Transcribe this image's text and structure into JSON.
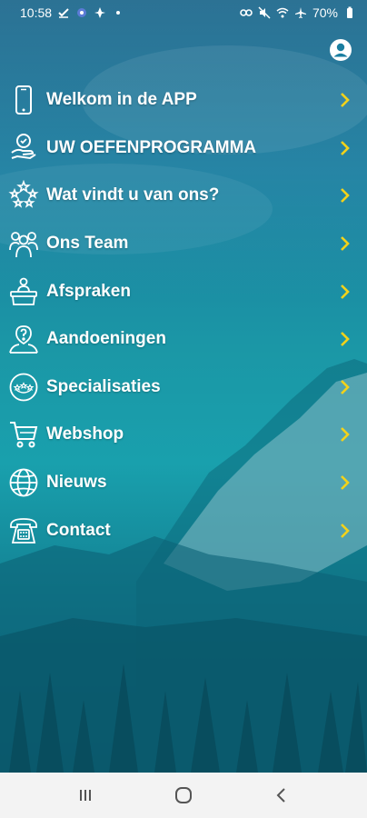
{
  "status_bar": {
    "time": "10:58",
    "battery": "70%",
    "left_icons": [
      "check-icon",
      "circle-app-icon",
      "pinwheel-icon",
      "dot-icon"
    ],
    "right_icons": [
      "link-icon",
      "mute-icon",
      "wifi-icon",
      "airplane-icon",
      "battery-icon"
    ]
  },
  "header": {
    "profile_icon": "profile-icon"
  },
  "menu": {
    "items": [
      {
        "label": "Welkom in de APP",
        "icon": "phone-icon"
      },
      {
        "label": "UW OEFENPROGRAMMA",
        "icon": "exercise-icon"
      },
      {
        "label": "Wat vindt u van ons?",
        "icon": "stars-icon"
      },
      {
        "label": "Ons Team",
        "icon": "team-icon"
      },
      {
        "label": "Afspraken",
        "icon": "reception-icon"
      },
      {
        "label": "Aandoeningen",
        "icon": "question-person-icon"
      },
      {
        "label": "Specialisaties",
        "icon": "badge-stars-icon"
      },
      {
        "label": "Webshop",
        "icon": "cart-icon"
      },
      {
        "label": "Nieuws",
        "icon": "globe-icon"
      },
      {
        "label": "Contact",
        "icon": "telephone-icon"
      }
    ]
  },
  "colors": {
    "chevron": "#f3d21a",
    "text": "#ffffff",
    "navbar": "#f3f3f3"
  },
  "navigation_bar": {
    "buttons": [
      "recents-icon",
      "home-icon",
      "back-icon"
    ]
  }
}
